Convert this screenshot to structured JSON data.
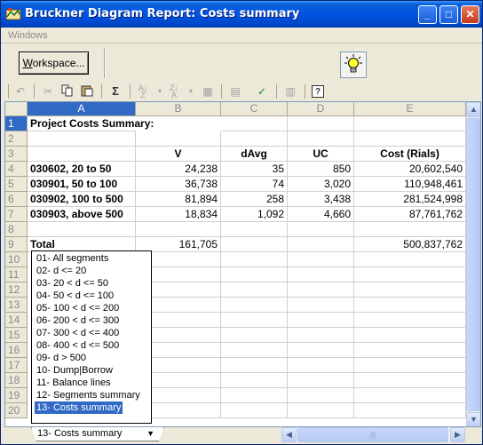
{
  "window": {
    "title": "Bruckner Diagram Report: Costs summary",
    "minimize": "_",
    "maximize": "□",
    "close": "✕"
  },
  "menu": {
    "windows": "Windows"
  },
  "toolbar": {
    "workspace_prefix": "W",
    "workspace_rest": "orkspace...",
    "icons": [
      "undo-icon",
      "cut-icon",
      "copy-icon",
      "paste-icon",
      "autosum-icon",
      "sort-ascending-icon",
      "sort-descending-icon",
      "format-icon",
      "chart-icon",
      "filter-icon",
      "properties-icon",
      "help-icon",
      "lightbulb-icon"
    ],
    "sigma": "Σ",
    "help": "?"
  },
  "columns": [
    "A",
    "B",
    "C",
    "D",
    "E"
  ],
  "rows": [
    "1",
    "2",
    "3",
    "4",
    "5",
    "6",
    "7",
    "8",
    "9",
    "10",
    "11",
    "12",
    "13",
    "14",
    "15",
    "16",
    "17",
    "18",
    "19",
    "20"
  ],
  "sheet": {
    "title": "Project Costs Summary:",
    "headers": {
      "v": "V",
      "davg": "dAvg",
      "uc": "UC",
      "cost": "Cost (Rials)"
    },
    "data": [
      {
        "name": "030602, 20 to 50",
        "v": "24,238",
        "davg": "35",
        "uc": "850",
        "cost": "20,602,540"
      },
      {
        "name": "030901, 50 to 100",
        "v": "36,738",
        "davg": "74",
        "uc": "3,020",
        "cost": "110,948,461"
      },
      {
        "name": "030902, 100 to 500",
        "v": "81,894",
        "davg": "258",
        "uc": "3,438",
        "cost": "281,524,998"
      },
      {
        "name": "030903, above 500",
        "v": "18,834",
        "davg": "1,092",
        "uc": "4,660",
        "cost": "87,761,762"
      }
    ],
    "total": {
      "label": "Total",
      "v": "161,705",
      "cost": "500,837,762"
    }
  },
  "dropdown": {
    "items": [
      "01-  All segments",
      "02-  d <= 20",
      "03-  20 < d <= 50",
      "04-  50 < d <= 100",
      "05-  100 < d <= 200",
      "06-  200 < d <= 300",
      "07-  300 < d <= 400",
      "08-  400 < d <= 500",
      "09-  d > 500",
      "10-  Dump|Borrow",
      "11-  Balance lines",
      "12-  Segments summary",
      "13-  Costs summary"
    ],
    "selected_index": 12
  },
  "tab": {
    "label": "13-  Costs summary",
    "arrow": "▼"
  },
  "scroll": {
    "up": "▲",
    "down": "▼",
    "left": "◀",
    "right": "▶",
    "grip": "|||"
  },
  "colors": {
    "title_bar": "#0054e3",
    "selection": "#316ac5"
  }
}
